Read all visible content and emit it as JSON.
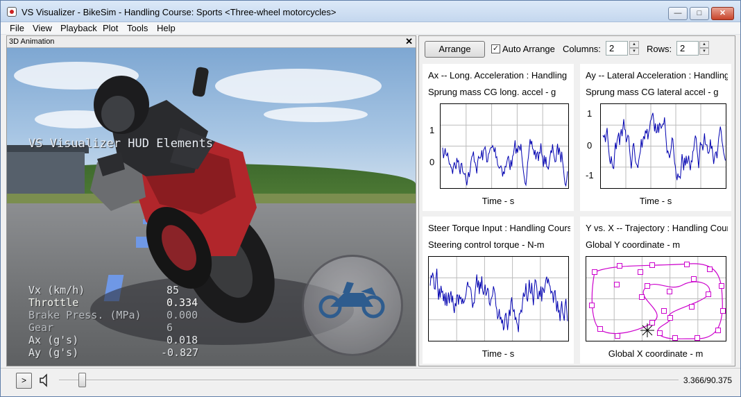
{
  "window": {
    "title": "VS Visualizer - BikeSim - Handling Course: Sports <Three-wheel motorcycles>",
    "minimize": "—",
    "maximize": "□",
    "close": "✕"
  },
  "menu": [
    "File",
    "View",
    "Playback",
    "Plot",
    "Tools",
    "Help"
  ],
  "animation": {
    "title": "3D Animation",
    "close": "✕",
    "hud_title": "VS Visualizer HUD Elements",
    "hud": [
      {
        "label": "Vx (km/h)",
        "value": "85"
      },
      {
        "label": "Throttle",
        "value": "0.334"
      },
      {
        "label": "Brake Press. (MPa)",
        "value": "0.000"
      },
      {
        "label": "Gear",
        "value": "6"
      },
      {
        "label": "Ax (g's)",
        "value": "0.018"
      },
      {
        "label": "Ay (g's)",
        "value": "-0.827"
      }
    ]
  },
  "toolbar": {
    "arrange": "Arrange",
    "auto_arrange": "Auto Arrange",
    "auto_arrange_checked": "✓",
    "columns_label": "Columns:",
    "columns": "2",
    "rows_label": "Rows:",
    "rows": "2"
  },
  "plots": [
    {
      "title": "Ax -- Long. Acceleration : Handling",
      "subtitle": "Sprung mass CG long. accel - g",
      "xlabel": "Time - s",
      "yticks": [
        "1",
        "0"
      ]
    },
    {
      "title": "Ay -- Lateral Acceleration : Handling",
      "subtitle": "Sprung mass CG lateral accel - g",
      "xlabel": "Time - s",
      "yticks": [
        "1",
        "0",
        "-1"
      ]
    },
    {
      "title": "Steer Torque Input : Handling Course",
      "subtitle": "Steering control torque - N-m",
      "xlabel": "Time - s",
      "yticks": []
    },
    {
      "title": "Y vs. X -- Trajectory : Handling Course",
      "subtitle": "Global Y coordinate - m",
      "xlabel": "Global X coordinate - m",
      "yticks": []
    }
  ],
  "playback": {
    "play": ">",
    "time": "3.366/90.375",
    "position_fraction": 0.037
  },
  "colors": {
    "trace": "#0000b0",
    "trajectory": "#cc00cc",
    "lane_marking": "#6f98e6"
  }
}
